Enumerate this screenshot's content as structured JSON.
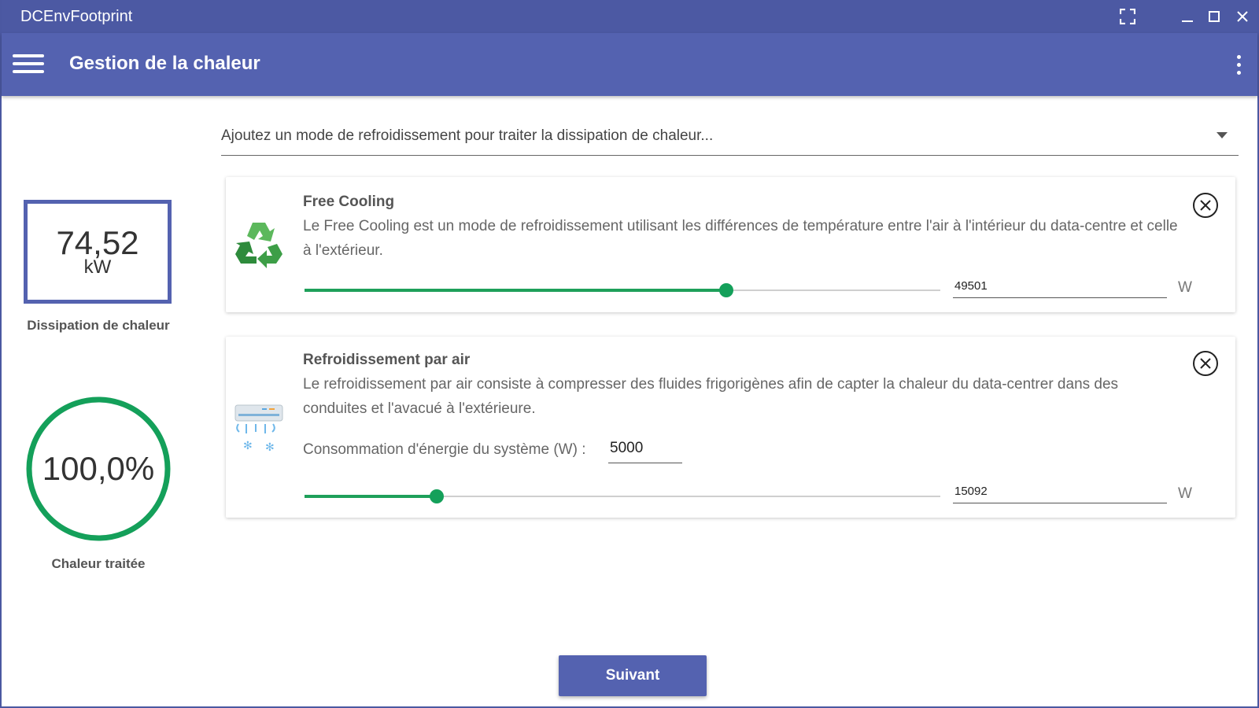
{
  "window": {
    "title": "DCEnvFootprint"
  },
  "appbar": {
    "title": "Gestion de la chaleur"
  },
  "stats": {
    "dissipation_value": "74,52",
    "dissipation_unit": "kW",
    "dissipation_label": "Dissipation de chaleur",
    "treated_value": "100,0%",
    "treated_fraction": 1.0,
    "treated_label": "Chaleur traitée"
  },
  "cooling_dropdown": {
    "placeholder": "Ajoutez un mode de refroidissement pour traiter la dissipation de chaleur..."
  },
  "cards": [
    {
      "title": "Free Cooling",
      "description": "Le Free Cooling est un mode de refroidissement utilisant les différences de température entre l'air à l'intérieur du data-centre et celle à l'extérieur.",
      "icon": "recycle-icon",
      "slider_fraction": 0.663,
      "value": "49501",
      "unit": "W"
    },
    {
      "title": "Refroidissement par air",
      "description": "Le refroidissement par air consiste à compresser des fluides frigorigènes afin de capter la chaleur du data-centrer dans des conduites et l'avacué à l'extérieure.",
      "icon": "air-conditioner-icon",
      "energy_label": "Consommation d'énergie du système (W) :",
      "energy_value": "5000",
      "slider_fraction": 0.208,
      "value": "15092",
      "unit": "W"
    }
  ],
  "footer": {
    "next_label": "Suivant"
  },
  "colors": {
    "primary": "#5462b0",
    "titlebar": "#4c59a3",
    "accent_green": "#14a05a"
  }
}
